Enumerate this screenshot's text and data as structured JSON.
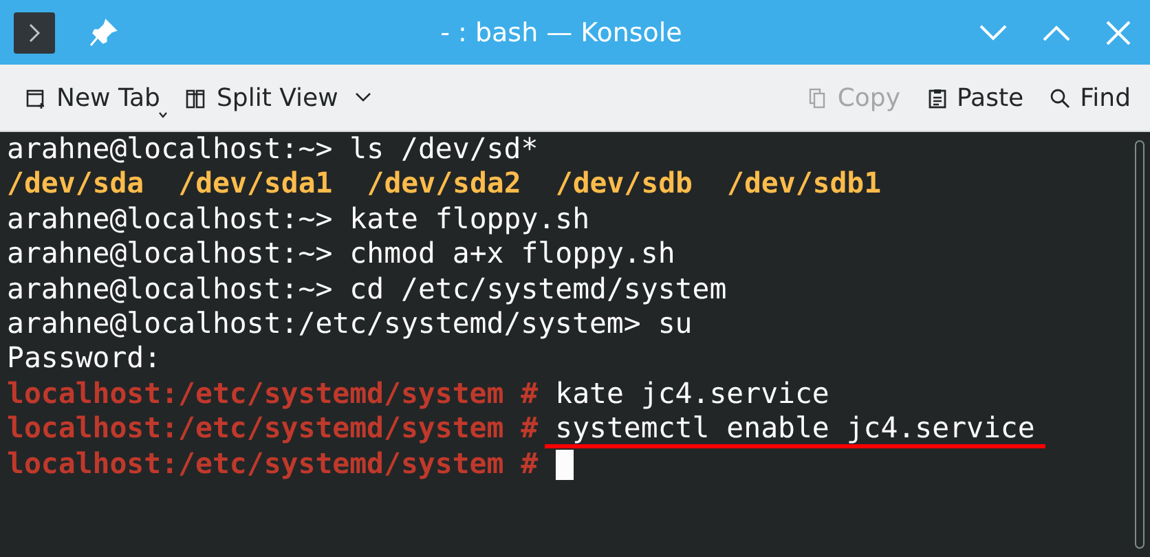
{
  "window": {
    "title": "- : bash — Konsole"
  },
  "toolbar": {
    "items": [
      {
        "label": "New Tab",
        "disabled": false
      },
      {
        "label": "Split View",
        "disabled": false
      },
      {
        "label": "Copy",
        "disabled": true
      },
      {
        "label": "Paste",
        "disabled": false
      },
      {
        "label": "Find",
        "disabled": false
      }
    ]
  },
  "terminal": {
    "lines": [
      {
        "kind": "input",
        "prompt": "arahne@localhost:~>",
        "root": false,
        "text": "ls /dev/sd*"
      },
      {
        "kind": "listing",
        "items": [
          "/dev/sda",
          "/dev/sda1",
          "/dev/sda2",
          "/dev/sdb",
          "/dev/sdb1"
        ]
      },
      {
        "kind": "input",
        "prompt": "arahne@localhost:~>",
        "root": false,
        "text": "kate floppy.sh"
      },
      {
        "kind": "input",
        "prompt": "arahne@localhost:~>",
        "root": false,
        "text": "chmod a+x floppy.sh"
      },
      {
        "kind": "input",
        "prompt": "arahne@localhost:~>",
        "root": false,
        "text": "cd /etc/systemd/system"
      },
      {
        "kind": "input",
        "prompt": "arahne@localhost:/etc/systemd/system>",
        "root": false,
        "text": "su"
      },
      {
        "kind": "output",
        "text": "Password:"
      },
      {
        "kind": "input",
        "prompt": "localhost:/etc/systemd/system #",
        "root": true,
        "text": "kate jc4.service"
      },
      {
        "kind": "input",
        "prompt": "localhost:/etc/systemd/system #",
        "root": true,
        "text": "systemctl enable jc4.service",
        "underlined": true
      },
      {
        "kind": "input",
        "prompt": "localhost:/etc/systemd/system #",
        "root": true,
        "cursor": true
      }
    ]
  }
}
